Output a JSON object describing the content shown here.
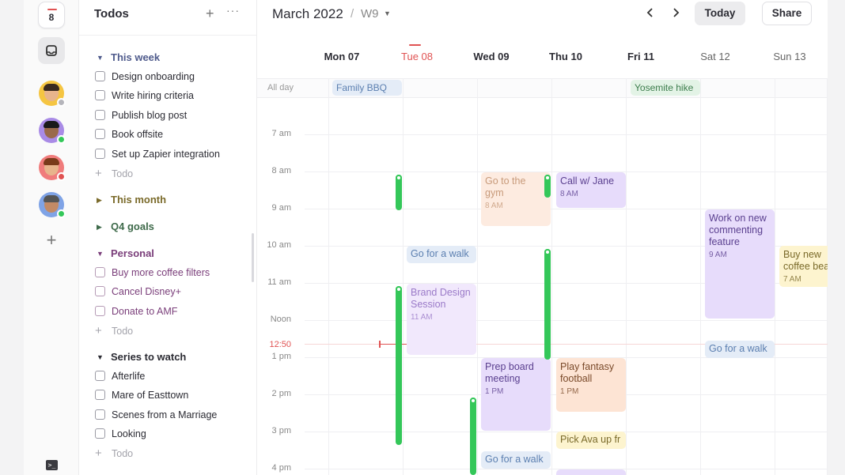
{
  "rail": {
    "date": "8"
  },
  "todos": {
    "title": "Todos",
    "add": "+",
    "more": "···",
    "add_todo": "Todo",
    "sections": [
      {
        "label": "This week",
        "color": "#4f5b8c",
        "items": [
          "Design onboarding",
          "Write hiring criteria",
          "Publish blog post",
          "Book offsite",
          "Set up Zapier integration"
        ]
      },
      {
        "label": "This month",
        "color": "#7a6a2a",
        "items": []
      },
      {
        "label": "Q4 goals",
        "color": "#3e6a4a",
        "items": []
      },
      {
        "label": "Personal",
        "color": "#7a3e7a",
        "items": [
          "Buy more coffee filters",
          "Cancel Disney+",
          "Donate to AMF"
        ]
      },
      {
        "label": "Series to watch",
        "color": "#2b2b33",
        "items": [
          "Afterlife",
          "Mare of Easttown",
          "Scenes from a Marriage",
          "Looking"
        ]
      }
    ]
  },
  "calendar": {
    "month": "March 2022",
    "sep": "/",
    "week": "W9",
    "today_btn": "Today",
    "share_btn": "Share",
    "days": [
      "Mon 07",
      "Tue 08",
      "Wed 09",
      "Thu 10",
      "Fri 11",
      "Sat 12",
      "Sun 13"
    ],
    "allday_label": "All day",
    "allday_events": [
      {
        "title": "Family BBQ",
        "bg": "#e4ecf7",
        "fg": "#5b7fb0"
      },
      {
        "title": "Yosemite hike",
        "bg": "#e3f3e6",
        "fg": "#3d7d4d"
      }
    ],
    "hours": [
      "7 am",
      "8 am",
      "9 am",
      "10 am",
      "11 am",
      "Noon",
      "1 pm",
      "2 pm",
      "3 pm",
      "4 pm"
    ],
    "now": "12:50",
    "events": [
      {
        "title": "Go to the gym",
        "time": "8 AM",
        "bg": "#fdebe0",
        "fg": "#c79a7a"
      },
      {
        "title": "Call w/ Jane",
        "time": "8 AM",
        "bg": "#e7dcfb",
        "fg": "#5a3f8f"
      },
      {
        "title": "Work on new commenting feature",
        "time": "9 AM",
        "bg": "#e7dcfb",
        "fg": "#5a3f8f"
      },
      {
        "title": "Go for a walk",
        "time": "",
        "bg": "#e4ecf7",
        "fg": "#5b7fb0"
      },
      {
        "title": "Buy new coffee beans",
        "time": "7 AM",
        "bg": "#fdf4cf",
        "fg": "#7a6a2a"
      },
      {
        "title": "Brand Design Session",
        "time": "11 AM",
        "bg": "#f1e8fc",
        "fg": "#9a7ac8"
      },
      {
        "title": "Go for a walk",
        "time": "",
        "bg": "#e4ecf7",
        "fg": "#5b7fb0"
      },
      {
        "title": "Prep board meeting",
        "time": "1 PM",
        "bg": "#e7dcfb",
        "fg": "#5a3f8f"
      },
      {
        "title": "Play fantasy football",
        "time": "1 PM",
        "bg": "#fde4d4",
        "fg": "#7a4a2a"
      },
      {
        "title": "Pick Ava up fr",
        "time": "",
        "bg": "#fdf4cf",
        "fg": "#7a6a2a"
      },
      {
        "title": "Go for a walk",
        "time": "",
        "bg": "#e4ecf7",
        "fg": "#5b7fb0"
      }
    ]
  }
}
